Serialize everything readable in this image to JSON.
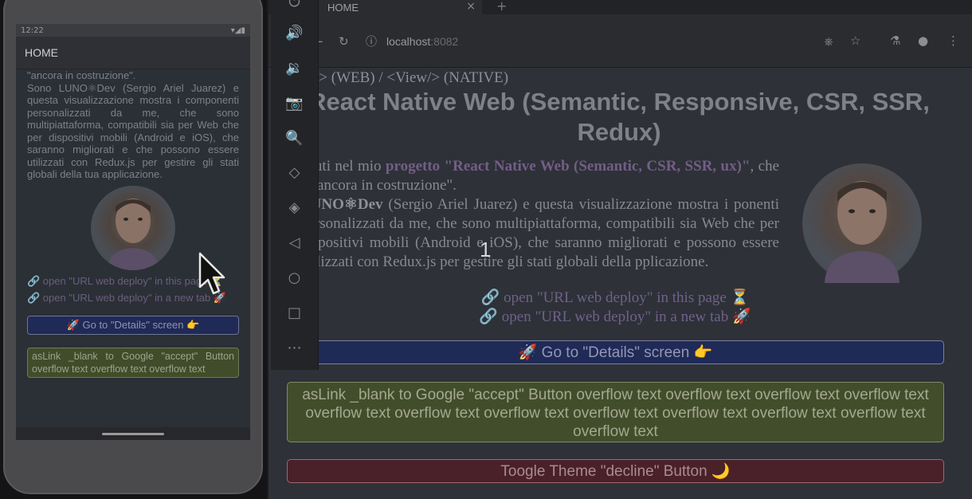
{
  "phone": {
    "status_time": "12:22",
    "app_title": "HOME",
    "intro_lines": [
      "\"ancora in costruzione\".",
      "Sono LUNO⚛Dev (Sergio Ariel Juarez) e questa visualizzazione mostra i componenti personalizzati da me, che sono multipiattaforma, compatibili sia per Web che per dispositivi mobili (Android e iOS), che saranno migliorati e che possono essere utilizzati con Redux.js per gestire gli stati globali della tua applicazione."
    ],
    "link_same_page": "🔗 open \"URL web deploy\" in this page ⏳",
    "link_new_tab": "🔗 open \"URL web deploy\" in a new tab 🚀",
    "details_button": "🚀 Go to \"Details\" screen 👉",
    "accept_button": "asLink _blank to Google \"accept\" Button overflow text overflow text overflow text"
  },
  "browser": {
    "tab_title": "HOME",
    "tab_close": "×",
    "new_tab": "+",
    "url_host": "localhost",
    "url_port": ":8082",
    "page": {
      "top_line": "/> (WEB) / <View/> (NATIVE)",
      "title": "React Native Web (Semantic, Responsive, CSR, SSR, Redux)",
      "para_prefix": "enuti nel mio ",
      "para_project": "progetto \"React Native Web (Semantic, CSR, SSR, ux)\"",
      "para_suffix": ", che è \"ancora in costruzione\".",
      "para_name": "LUNO⚛Dev",
      "para_rest": " (Sergio Ariel Juarez) e questa visualizzazione mostra i ponenti personalizzati da me, che sono multipiattaforma, compatibili sia Web che per dispositivi mobili (Android e iOS), che saranno migliorati e possono essere utilizzati con Redux.js per gestire gli stati globali della pplicazione.",
      "link_same_page": "🔗 open \"URL web deploy\" in this page ⏳",
      "link_new_tab": "🔗 open \"URL web deploy\" in a new tab 🚀",
      "details_button": "🚀 Go to \"Details\" screen 👉",
      "accept_button": "asLink _blank to Google \"accept\" Button overflow text overflow text overflow text overflow text overflow text overflow text overflow text overflow text overflow text overflow text overflow text overflow text",
      "theme_button": "Toogle Theme \"decline\" Button 🌙"
    }
  },
  "overlay_counter": "1"
}
